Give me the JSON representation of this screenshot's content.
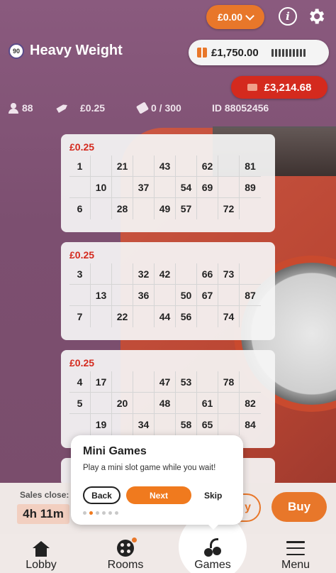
{
  "header": {
    "balance": "£0.00",
    "room_name": "Heavy Weight",
    "room_ball": "90",
    "jackpot": "£1,750.00",
    "progressive": "£3,214.68"
  },
  "stats": {
    "players": "88",
    "ticket_price": "£0.25",
    "tickets": "0 / 300",
    "game_id": "ID 88052456"
  },
  "tickets": [
    {
      "price": "£0.25",
      "rows": [
        [
          "1",
          "",
          "21",
          "",
          "43",
          "",
          "62",
          "",
          "81"
        ],
        [
          "",
          "10",
          "",
          "37",
          "",
          "54",
          "69",
          "",
          "89"
        ],
        [
          "6",
          "",
          "28",
          "",
          "49",
          "57",
          "",
          "72",
          ""
        ]
      ]
    },
    {
      "price": "£0.25",
      "rows": [
        [
          "3",
          "",
          "",
          "32",
          "42",
          "",
          "66",
          "73",
          ""
        ],
        [
          "",
          "13",
          "",
          "36",
          "",
          "50",
          "67",
          "",
          "87"
        ],
        [
          "7",
          "",
          "22",
          "",
          "44",
          "56",
          "",
          "74",
          ""
        ]
      ]
    },
    {
      "price": "£0.25",
      "rows": [
        [
          "4",
          "17",
          "",
          "",
          "47",
          "53",
          "",
          "78",
          ""
        ],
        [
          "5",
          "",
          "20",
          "",
          "48",
          "",
          "61",
          "",
          "82"
        ],
        [
          "",
          "19",
          "",
          "34",
          "",
          "58",
          "65",
          "",
          "84"
        ]
      ]
    }
  ],
  "sales": {
    "label": "Sales close:",
    "time": "4h 11m",
    "buy_partial": "y",
    "buy": "Buy"
  },
  "popup": {
    "title": "Mini Games",
    "text": "Play a mini slot game while you wait!",
    "back": "Back",
    "next": "Next",
    "skip": "Skip"
  },
  "nav": {
    "lobby": "Lobby",
    "rooms": "Rooms",
    "games": "Games",
    "menu": "Menu"
  },
  "colors": {
    "accent": "#e8772a",
    "price_red": "#d42a1e",
    "background": "#8a5a78"
  }
}
